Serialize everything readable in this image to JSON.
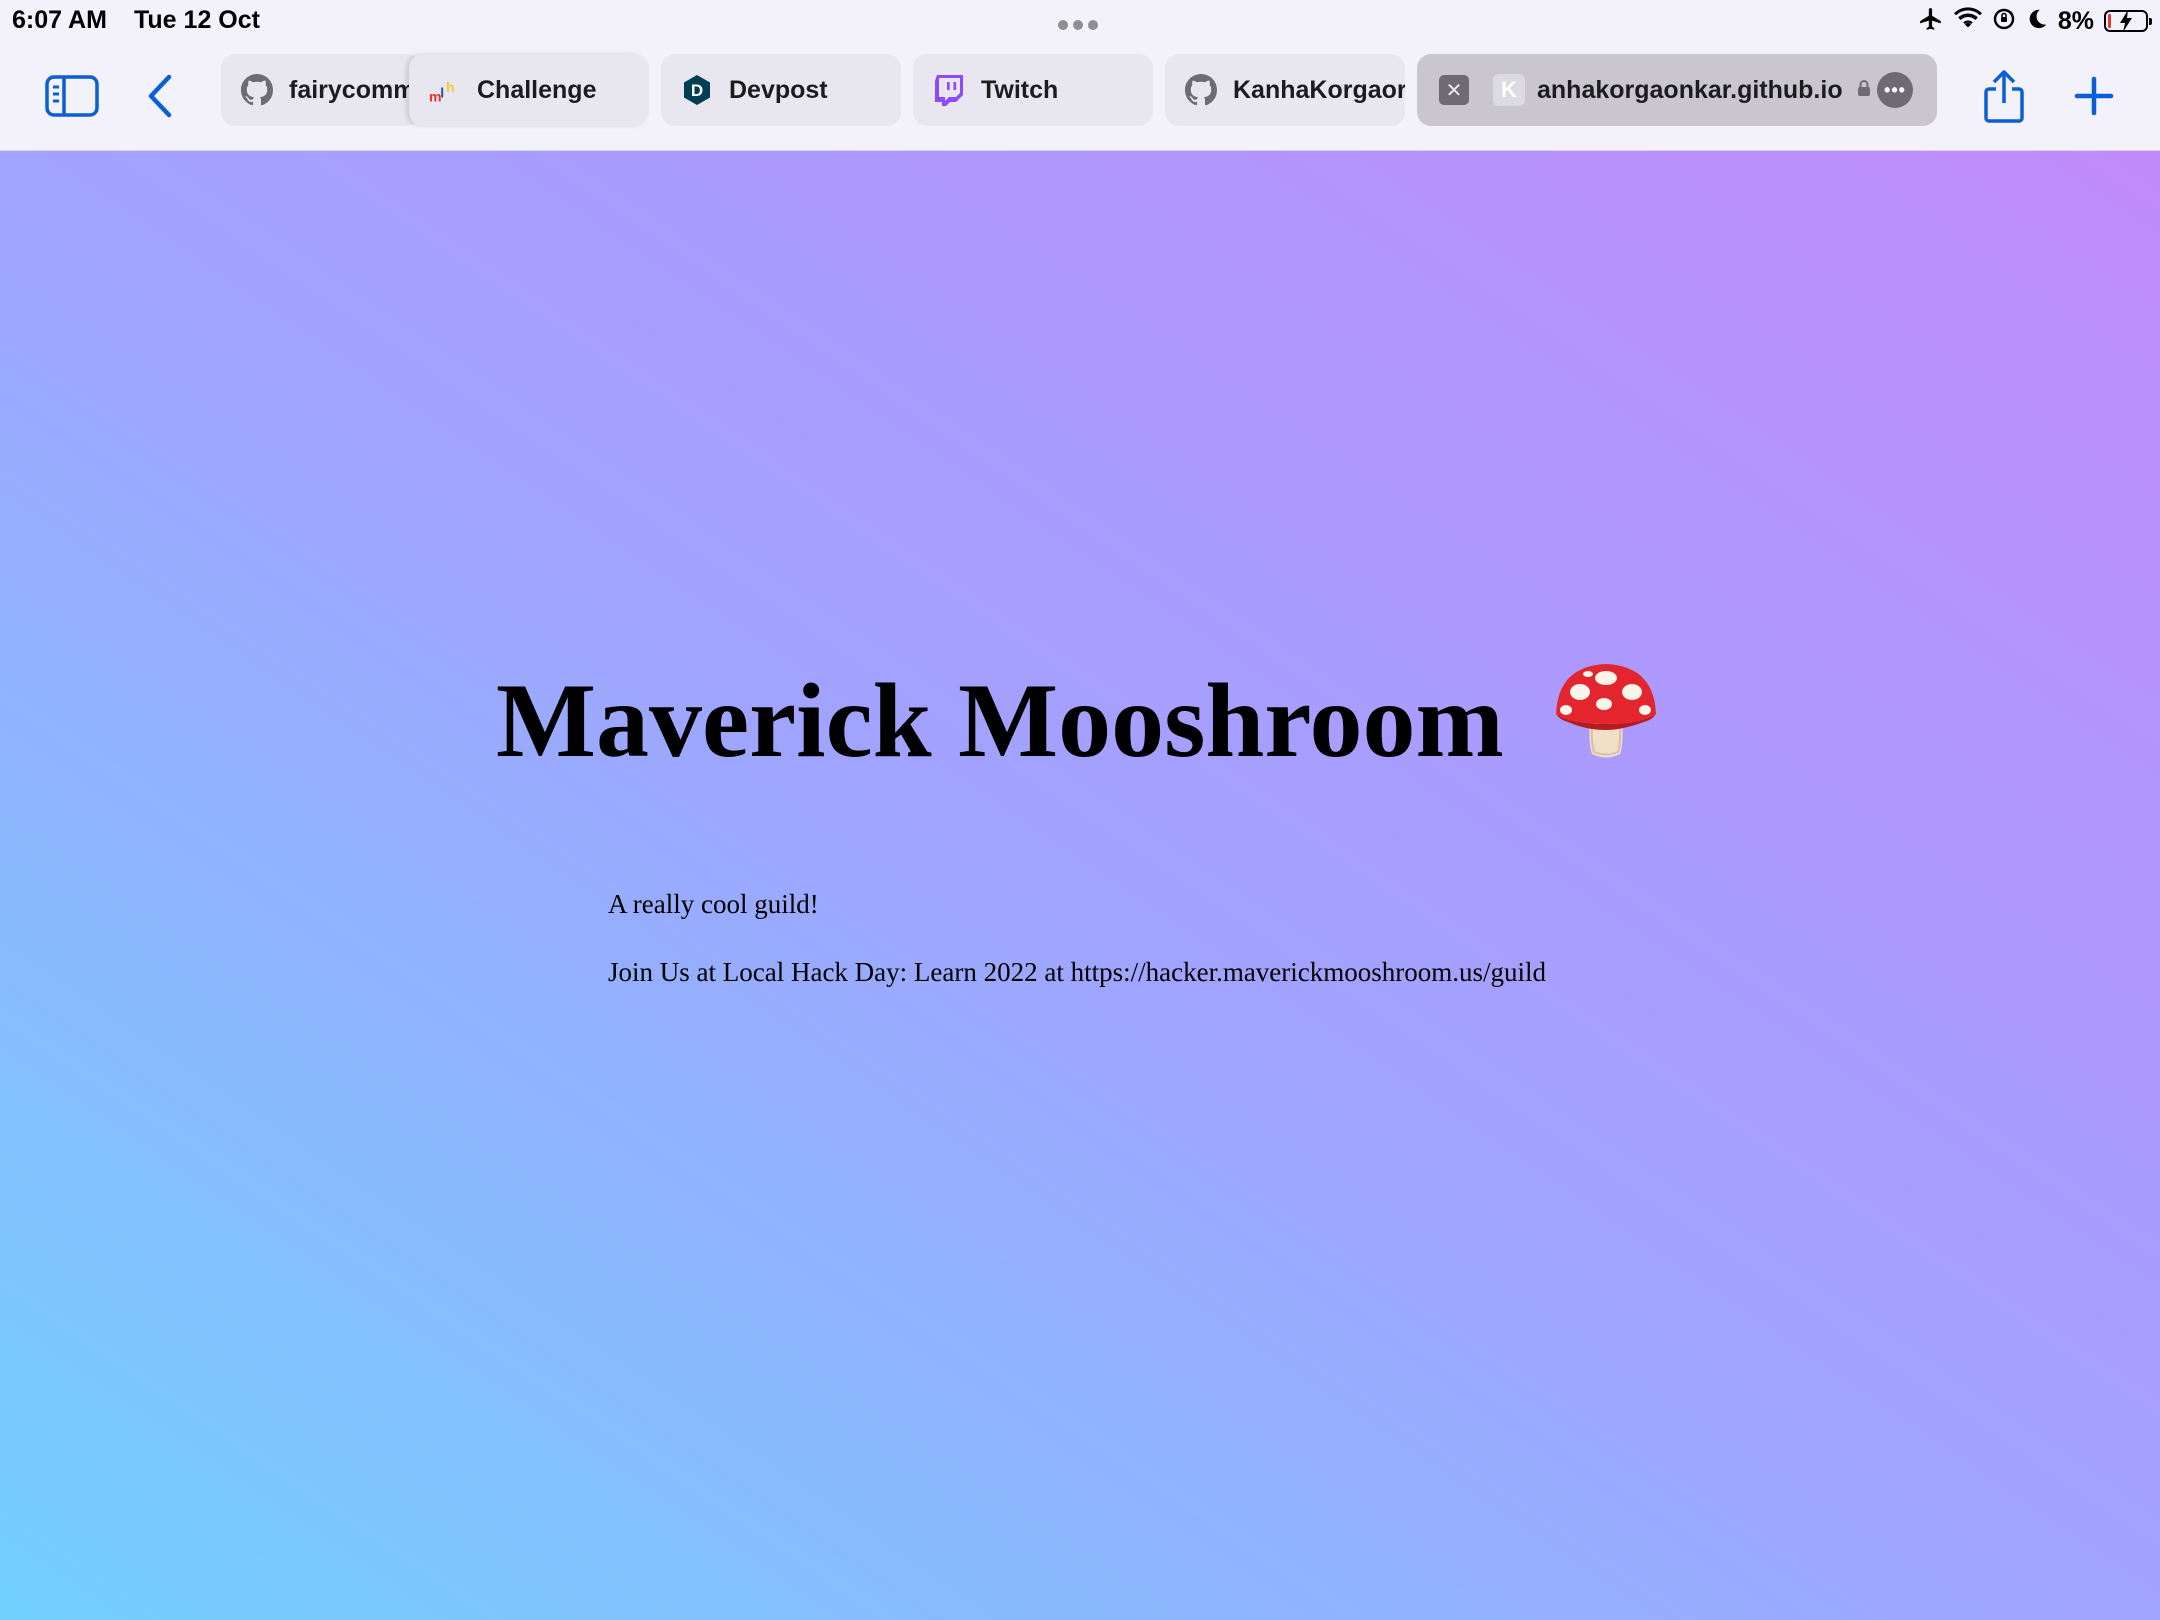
{
  "status_bar": {
    "time": "6:07 AM",
    "date": "Tue 12 Oct",
    "battery_percent": "8%",
    "battery_level": 0.08,
    "icons": [
      "airplane-icon",
      "wifi-icon",
      "orientation-lock-icon",
      "moon-icon",
      "battery-charging-icon"
    ]
  },
  "toolbar": {
    "left_icons": [
      "sidebar-icon",
      "back-chevron-icon"
    ],
    "right_icons": [
      "share-icon",
      "plus-icon"
    ],
    "accent_color": "#0a5fd6"
  },
  "tabs": [
    {
      "label": "fairycomm",
      "icon": "github-icon"
    },
    {
      "label": "Challenge",
      "icon": "mlh-icon"
    },
    {
      "label": "Devpost",
      "icon": "devpost-icon",
      "icon_letter": "D"
    },
    {
      "label": "Twitch",
      "icon": "twitch-icon"
    },
    {
      "label": "KanhaKorgaor",
      "icon": "github-icon"
    },
    {
      "label": "anhakorgaonkar.github.io",
      "icon": "k-favicon",
      "icon_letter": "K",
      "active": true
    }
  ],
  "page": {
    "title": "Maverick Mooshroom",
    "title_emoji": "mushroom-emoji",
    "tagline": "A really cool guild!",
    "join_text": "Join Us at Local Hack Day: Learn 2022 at https://hacker.maverickmooshroom.us/guild",
    "gradient_colors": [
      "#72d0ff",
      "#a1a3fe",
      "#c08afd"
    ]
  }
}
